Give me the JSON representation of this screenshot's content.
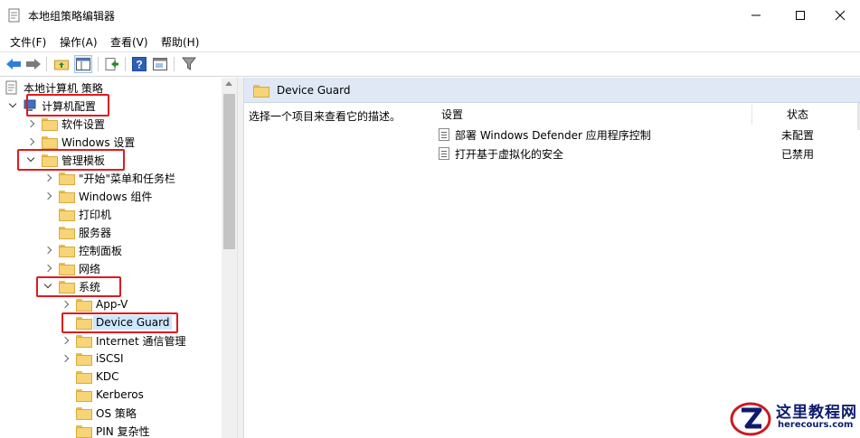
{
  "window": {
    "title": "本地组策略编辑器"
  },
  "menu": {
    "items": [
      "文件(F)",
      "操作(A)",
      "查看(V)",
      "帮助(H)"
    ]
  },
  "tree": {
    "root": "本地计算机 策略",
    "nodes": [
      {
        "label": "计算机配置",
        "expanded": true
      },
      {
        "label": "软件设置"
      },
      {
        "label": "Windows 设置"
      },
      {
        "label": "管理模板",
        "expanded": true
      },
      {
        "label": "\"开始\"菜单和任务栏"
      },
      {
        "label": "Windows 组件"
      },
      {
        "label": "打印机"
      },
      {
        "label": "服务器"
      },
      {
        "label": "控制面板"
      },
      {
        "label": "网络"
      },
      {
        "label": "系统",
        "expanded": true
      },
      {
        "label": "App-V"
      },
      {
        "label": "Device Guard",
        "selected": true
      },
      {
        "label": "Internet 通信管理"
      },
      {
        "label": "iSCSI"
      },
      {
        "label": "KDC"
      },
      {
        "label": "Kerberos"
      },
      {
        "label": "OS 策略"
      },
      {
        "label": "PIN 复杂性"
      }
    ]
  },
  "content": {
    "header": "Device Guard",
    "description": "选择一个项目来查看它的描述。",
    "columns": {
      "setting": "设置",
      "state": "状态"
    },
    "rows": [
      {
        "setting": "部署 Windows Defender 应用程序控制",
        "state": "未配置"
      },
      {
        "setting": "打开基于虚拟化的安全",
        "state": "已禁用"
      }
    ]
  },
  "watermark": {
    "title": "这里教程网",
    "url": "herecours.com"
  },
  "colors": {
    "highlight": "#e0191e",
    "header_bg": "#dfe8f4",
    "selection": "#cce8ff",
    "folder": "#f6d477"
  }
}
